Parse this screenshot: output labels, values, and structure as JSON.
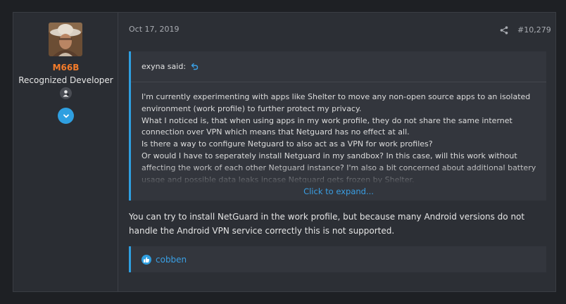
{
  "author": {
    "username": "M66B",
    "title": "Recognized Developer",
    "avatar_icon": "user-avatar-photo",
    "badge_icon": "developer-badge-icon",
    "expand_icon": "chevron-down-icon"
  },
  "post": {
    "date": "Oct 17, 2019",
    "number": "#10,279",
    "share_icon": "share-icon"
  },
  "quote": {
    "author_line": "exyna said:",
    "lines": [
      "I'm currently experimenting with apps like Shelter to move any non-open source apps to an isolated environment (work profile) to further protect my privacy.",
      "What I noticed is, that when using apps in my work profile, they do not share the same internet connection over VPN which means that Netguard has no effect at all.",
      "Is there a way to configure Netguard to also act as a VPN for work profiles?",
      "Or would I have to seperately install Netguard in my sandbox? In this case, will this work without affecting the work of each other Netguard instance? I'm also a bit concerned about additional battery usage and possible data leaks incase Netguard gets frozen by Shelter."
    ],
    "expand_label": "Click to expand..."
  },
  "reply": {
    "text": "You can try to install NetGuard in the work profile, but because many Android versions do not handle the Android VPN service correctly this is not supported."
  },
  "reactions": {
    "icon": "like-icon",
    "users": "cobben"
  },
  "colors": {
    "accent": "#2f9fe0",
    "username": "#f57c2a",
    "background": "#1e2024",
    "panel": "#2c2f35"
  }
}
